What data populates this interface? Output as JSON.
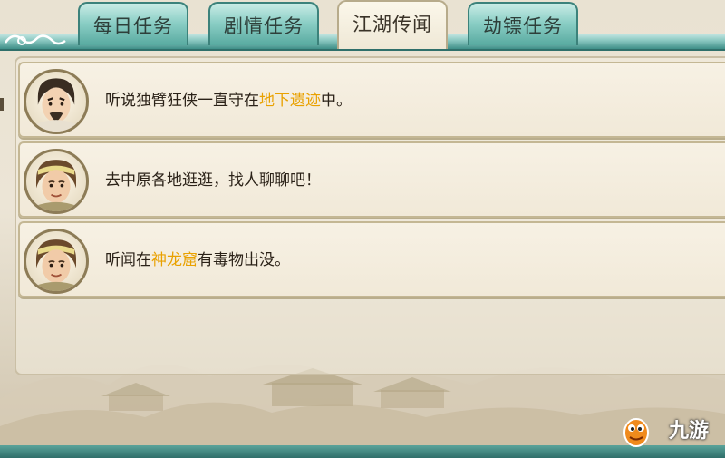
{
  "tabs": [
    {
      "label": "每日任务",
      "active": false
    },
    {
      "label": "剧情任务",
      "active": false
    },
    {
      "label": "江湖传闻",
      "active": true
    },
    {
      "label": "劫镖任务",
      "active": false
    }
  ],
  "rumors": [
    {
      "avatar": "bearded-hero-avatar",
      "text_before": "听说独臂狂侠一直守在",
      "highlight": "地下遗迹",
      "text_after": "中。"
    },
    {
      "avatar": "young-villager-avatar",
      "text_before": "去中原各地逛逛，找人聊聊吧！",
      "highlight": "",
      "text_after": ""
    },
    {
      "avatar": "young-villager-avatar",
      "text_before": "听闻在",
      "highlight": "神龙窟",
      "text_after": "有毒物出没。"
    }
  ],
  "logo": {
    "text": "九游",
    "mascot_icon": "jiuyou-mascot-icon"
  },
  "colors": {
    "highlight": "#e9a100",
    "tab_teal": "#8ccfc6",
    "frame": "#3f8f88"
  }
}
